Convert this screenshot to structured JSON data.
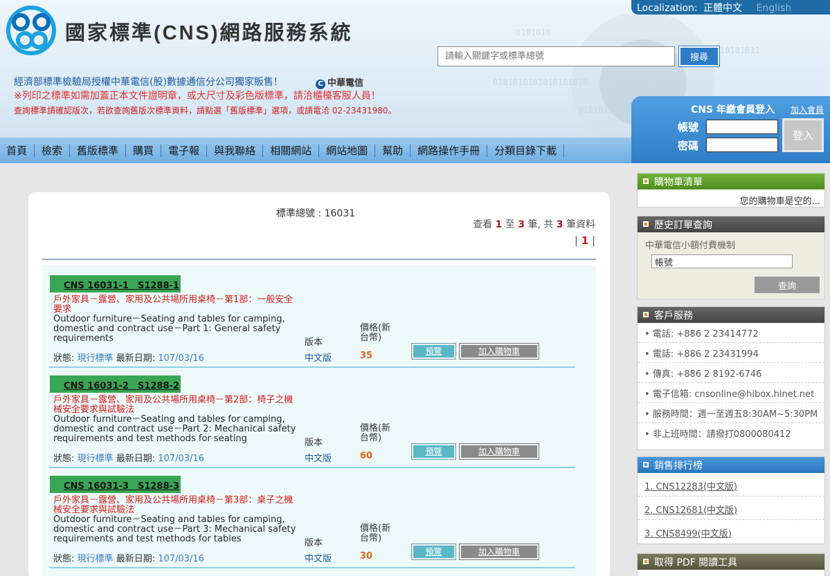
{
  "header": {
    "site_title": "國家標準(CNS)網路服務系統",
    "localization": {
      "label": "Localization:",
      "current": "正體中文",
      "other": "English"
    },
    "search": {
      "placeholder": "請輸入關鍵字或標準總號",
      "button": "搜尋"
    },
    "notices": [
      "經濟部標準檢驗局授權中華電信(股)數據通信分公司獨家販售！",
      "※列印之標準如需加蓋正本文件證明章，或大尺寸及彩色版標準，請洽櫃檯客服人員！",
      "查詢標準請確認版次，若欲查詢舊版次標準資料，請點選「舊版標準」選項，或請電洽 02-23431980。"
    ],
    "partner_logo": "中華電信",
    "binary_text": [
      "0101010",
      "10101011",
      "0101010101010101010",
      "0101010101"
    ]
  },
  "login": {
    "title": "CNS 年繳會員登入",
    "join_link": "加入會員",
    "account_label": "帳號",
    "password_label": "密碼",
    "button": "登入"
  },
  "nav": {
    "items": [
      "首頁",
      "檢索",
      "舊版標準",
      "購買",
      "電子報",
      "與我聯絡",
      "相關網站",
      "網站地圖",
      "幫助",
      "網路操作手冊",
      "分類目錄下載"
    ]
  },
  "main": {
    "std_number": "標準總號 : 16031",
    "summary": {
      "prefix": "查看",
      "from": "1",
      "to_word": "至",
      "to": "3",
      "unit": "筆, 共",
      "total": "3",
      "suffix": "筆資料"
    },
    "pagination": {
      "left": "|",
      "current": "1",
      "right": "|"
    },
    "status_label": "狀態:",
    "date_label": "最新日期:",
    "edition_label": "版本",
    "price_label": "價格(新台幣)",
    "preview_button": "預覽",
    "cart_button": "加入購物車",
    "results": [
      {
        "code": "CNS 16031-1　S1288-1",
        "title_zh": "戶外家具－露營、家用及公共場所用桌椅－第1部：一般安全要求",
        "title_en": "Outdoor furniture－Seating and tables for camping, domestic and contract use－Part 1: General safety requirements",
        "status": "現行標準",
        "date": "107/03/16",
        "edition": "中文版",
        "price": "35"
      },
      {
        "code": "CNS 16031-2　S1288-2",
        "title_zh": "戶外家具－露營、家用及公共場所用桌椅－第2部：椅子之機械安全要求與試驗法",
        "title_en": "Outdoor furniture－Seating and tables for camping, domestic and contract use－Part 2: Mechanical safety requirements and test methods for seating",
        "status": "現行標準",
        "date": "107/03/16",
        "edition": "中文版",
        "price": "60"
      },
      {
        "code": "CNS 16031-3　S1288-3",
        "title_zh": "戶外家具－露營、家用及公共場所用桌椅－第3部：桌子之機械安全要求與試驗法",
        "title_en": "Outdoor furniture－Seating and tables for camping, domestic and contract use－Part 3: Mechanical safety requirements and test methods for tables",
        "status": "現行標準",
        "date": "107/03/16",
        "edition": "中文版",
        "price": "30"
      }
    ]
  },
  "sidebar": {
    "cart": {
      "title": "購物車清單",
      "empty": "您的購物車是空的..."
    },
    "history": {
      "title": "歷史訂單查詢",
      "subtitle": "中華電信小額付費機制",
      "field_value": "帳號",
      "button": "查詢"
    },
    "service": {
      "title": "客戶服務",
      "lines": [
        "• 電話: +886 2 23414772",
        "• 電話: +886 2 23431994",
        "• 傳真: +886 2 8192-6746",
        "• 電子信箱: cnsonline@hibox.hinet.net",
        "• 服務時間：週一至週五8:30AM~5:30PM",
        "• 非上班時間：請撥打0800080412"
      ]
    },
    "ranking": {
      "title": "銷售排行榜",
      "items": [
        "1. CNS12283(中文版)",
        "2. CNS12681(中文版)",
        "3. CNS8499(中文版)"
      ]
    },
    "pdf": {
      "title": "取得 PDF 閱讀工具"
    }
  },
  "colors": {
    "accent_blue": "#2f7ec6",
    "nav_blue": "#6eaee2",
    "code_green": "#3aa655",
    "title_red": "#d01b1b",
    "price_orange": "#e46419"
  }
}
